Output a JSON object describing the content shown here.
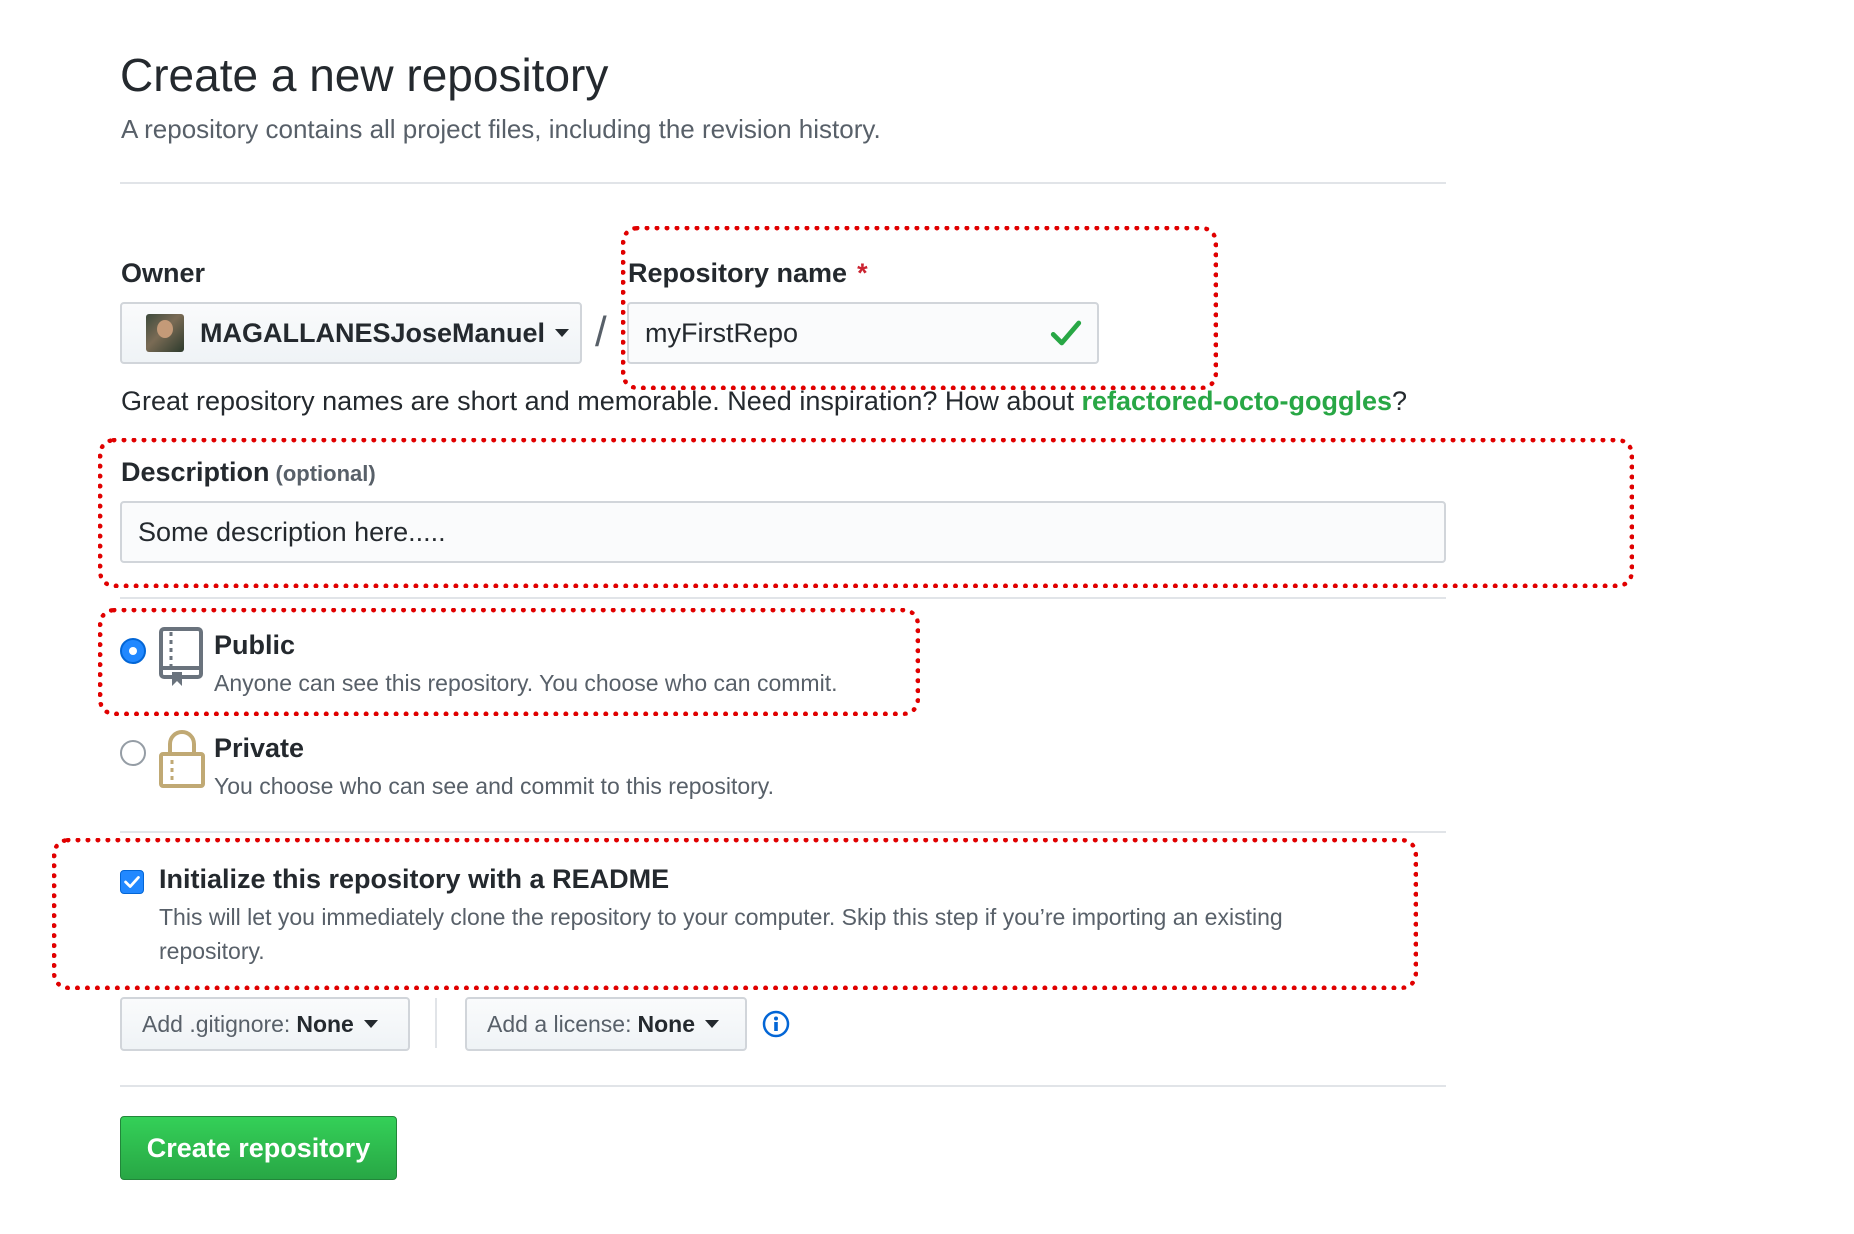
{
  "header": {
    "title": "Create a new repository",
    "subtitle": "A repository contains all project files, including the revision history."
  },
  "owner": {
    "label": "Owner",
    "value": "MAGALLANESJoseManuel"
  },
  "separator": "/",
  "repo_name": {
    "label": "Repository name",
    "required_mark": "*",
    "value": "myFirstRepo",
    "valid": true
  },
  "hint": {
    "text": "Great repository names are short and memorable. Need inspiration? How about ",
    "suggestion": "refactored-octo-goggles",
    "end": "?"
  },
  "description": {
    "label": "Description",
    "optional": "(optional)",
    "value": "Some description here....."
  },
  "visibility": {
    "selected": "public",
    "public": {
      "title": "Public",
      "desc": "Anyone can see this repository. You choose who can commit."
    },
    "private": {
      "title": "Private",
      "desc": "You choose who can see and commit to this repository."
    }
  },
  "readme": {
    "checked": true,
    "title": "Initialize this repository with a README",
    "desc": "This will let you immediately clone the repository to your computer. Skip this step if you’re importing an existing repository."
  },
  "gitignore": {
    "label": "Add .gitignore:",
    "value": "None"
  },
  "license": {
    "label": "Add a license:",
    "value": "None"
  },
  "create_button": "Create repository",
  "colors": {
    "accent_green": "#28a745",
    "annotation_red": "#e00000",
    "radio_blue": "#2188ff"
  }
}
